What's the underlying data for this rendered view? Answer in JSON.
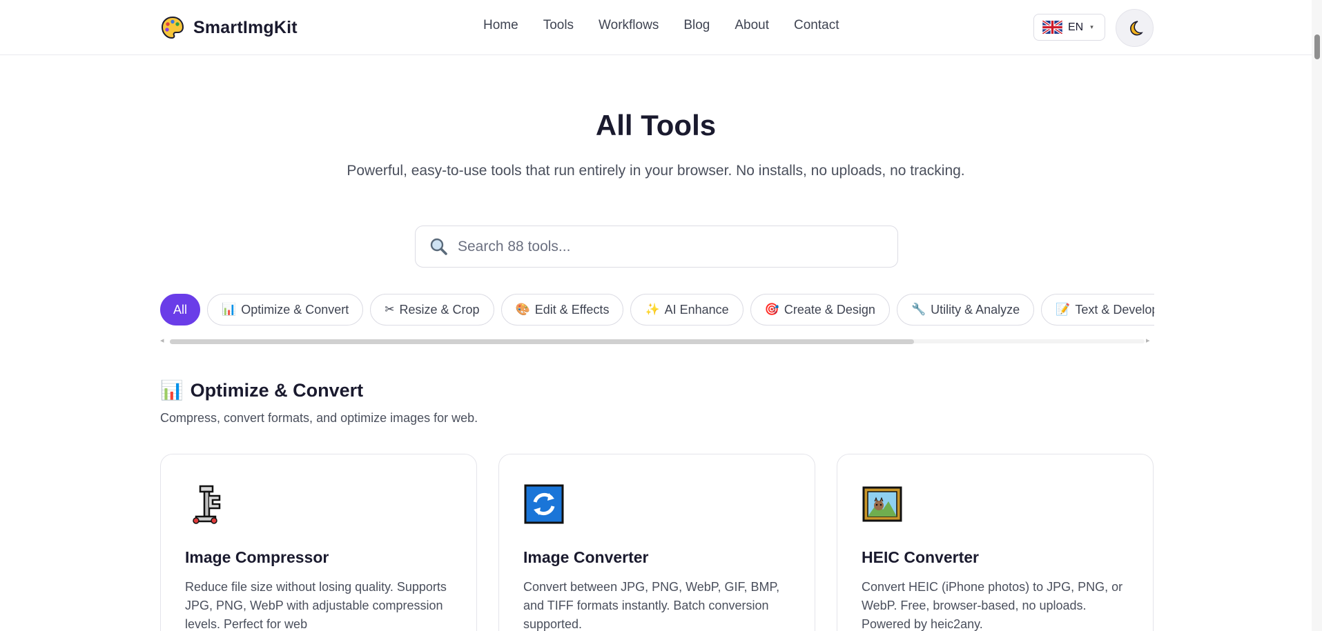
{
  "brand": {
    "name": "SmartImgKit",
    "logo_icon": "palette-icon"
  },
  "nav": {
    "items": [
      {
        "label": "Home"
      },
      {
        "label": "Tools"
      },
      {
        "label": "Workflows"
      },
      {
        "label": "Blog"
      },
      {
        "label": "About"
      },
      {
        "label": "Contact"
      }
    ]
  },
  "language": {
    "code": "EN",
    "flag_icon": "uk-flag-icon"
  },
  "theme_toggle": {
    "icon": "moon-icon"
  },
  "hero": {
    "title": "All Tools",
    "subtitle": "Powerful, easy-to-use tools that run entirely in your browser. No installs, no uploads, no tracking."
  },
  "search": {
    "placeholder": "Search 88 tools...",
    "value": ""
  },
  "filters": [
    {
      "label": "All",
      "icon": "",
      "active": true
    },
    {
      "label": "Optimize & Convert",
      "icon": "📊",
      "active": false
    },
    {
      "label": "Resize & Crop",
      "icon": "✂",
      "active": false
    },
    {
      "label": "Edit & Effects",
      "icon": "🎨",
      "active": false
    },
    {
      "label": "AI Enhance",
      "icon": "✨",
      "active": false
    },
    {
      "label": "Create & Design",
      "icon": "🎯",
      "active": false
    },
    {
      "label": "Utility & Analyze",
      "icon": "🔧",
      "active": false
    },
    {
      "label": "Text & Developer",
      "icon": "📝",
      "active": false
    }
  ],
  "section": {
    "icon": "📊",
    "title": "Optimize & Convert",
    "description": "Compress, convert formats, and optimize images for web."
  },
  "cards": [
    {
      "icon": "clamp-icon",
      "title": "Image Compressor",
      "description": "Reduce file size without losing quality. Supports JPG, PNG, WebP with adjustable compression levels. Perfect for web"
    },
    {
      "icon": "refresh-arrows-icon",
      "title": "Image Converter",
      "description": "Convert between JPG, PNG, WebP, GIF, BMP, and TIFF formats instantly. Batch conversion supported."
    },
    {
      "icon": "framed-picture-icon",
      "title": "HEIC Converter",
      "description": "Convert HEIC (iPhone photos) to JPG, PNG, or WebP. Free, browser-based, no uploads. Powered by heic2any."
    }
  ],
  "colors": {
    "accent": "#6a3de8",
    "text": "#1a1a2e",
    "muted": "#4a4f5c",
    "border": "#dcdce4"
  }
}
